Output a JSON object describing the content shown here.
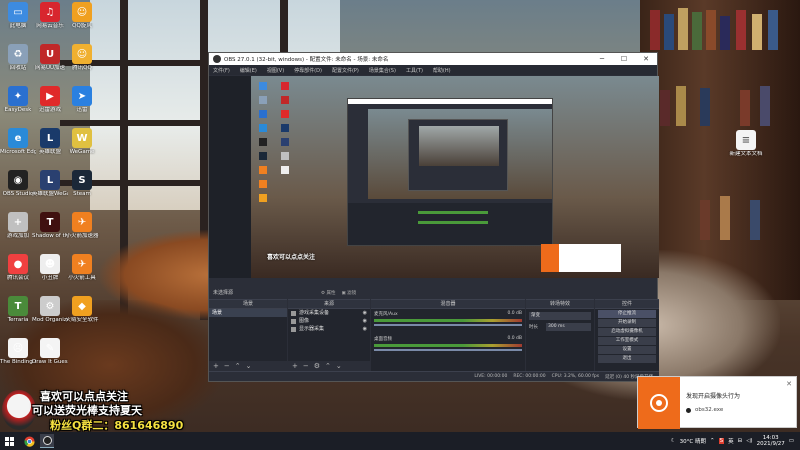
{
  "desktop_icons": [
    {
      "label": "此电脑",
      "color": "#3d8be0",
      "glyph": "▭",
      "icon": "computer-icon"
    },
    {
      "label": "网易云音乐",
      "color": "#d8262e",
      "glyph": "♫",
      "icon": "music-icon"
    },
    {
      "label": "QQ旋风",
      "color": "#f0a020",
      "glyph": "☺",
      "icon": "qq-icon"
    },
    {
      "label": "回收站",
      "color": "#8aa0b8",
      "glyph": "♻",
      "icon": "recycle-bin-icon"
    },
    {
      "label": "网易UU加速",
      "color": "#c02828",
      "glyph": "U",
      "icon": "uu-icon"
    },
    {
      "label": "腾讯QQ",
      "color": "#f0b030",
      "glyph": "☺",
      "icon": "qq-icon"
    },
    {
      "label": "EasyDesk",
      "color": "#2a70d0",
      "glyph": "✦",
      "icon": "app-icon"
    },
    {
      "label": "迅雷游戏",
      "color": "#e02a2a",
      "glyph": "▶",
      "icon": "game-icon"
    },
    {
      "label": "迅雷",
      "color": "#2a80e0",
      "glyph": "➤",
      "icon": "thunder-icon"
    },
    {
      "label": "Microsoft Edge",
      "color": "#2a8ad8",
      "glyph": "e",
      "icon": "edge-icon"
    },
    {
      "label": "英雄联盟",
      "color": "#1a3a6a",
      "glyph": "L",
      "icon": "lol-icon"
    },
    {
      "label": "WeGame",
      "color": "#e0c040",
      "glyph": "W",
      "icon": "wegame-icon"
    },
    {
      "label": "OBS Studio",
      "color": "#222",
      "glyph": "◉",
      "icon": "obs-icon"
    },
    {
      "label": "英雄联盟WeGame版",
      "color": "#2a4070",
      "glyph": "L",
      "icon": "lol-icon"
    },
    {
      "label": "Steam",
      "color": "#1b2838",
      "glyph": "S",
      "icon": "steam-icon"
    },
    {
      "label": "游戏加加",
      "color": "#c0c0c0",
      "glyph": "+",
      "icon": "app-icon"
    },
    {
      "label": "Shadow of the Tomb Raider",
      "color": "#401010",
      "glyph": "T",
      "icon": "game-icon"
    },
    {
      "label": "小火箭加速器",
      "color": "#f08020",
      "glyph": "✈",
      "icon": "rocket-icon"
    },
    {
      "label": "腾讯会议",
      "color": "#f04040",
      "glyph": "●",
      "icon": "app-icon"
    },
    {
      "label": "小丑牌",
      "color": "#eee",
      "glyph": "☻",
      "icon": "game-icon"
    },
    {
      "label": "小火箭工具",
      "color": "#f08020",
      "glyph": "✈",
      "icon": "rocket-icon"
    },
    {
      "label": "Terraria",
      "color": "#4a8a3a",
      "glyph": "T",
      "icon": "terraria-icon"
    },
    {
      "label": "Mod Organizer",
      "color": "#ccc",
      "glyph": "⚙",
      "icon": "app-icon"
    },
    {
      "label": "火绒安全软件",
      "color": "#f0a020",
      "glyph": "◆",
      "icon": "shield-icon"
    },
    {
      "label": "The Binding of Isaac: Re...",
      "color": "#f4f4f4",
      "glyph": "☹",
      "icon": "isaac-icon"
    },
    {
      "label": "Draw It Guess",
      "color": "#f4f4f4",
      "glyph": "✎",
      "icon": "draw-icon"
    }
  ],
  "desktop_right_icon": {
    "label": "新建文本文档",
    "icon": "text-file-icon"
  },
  "obs": {
    "title": "OBS 27.0.1 (32-bit, windows) - 配置文件: 未命名 - 场景: 未命名",
    "menu": [
      "文件(F)",
      "编辑(E)",
      "视图(V)",
      "停靠部件(D)",
      "配置文件(P)",
      "场景集合(S)",
      "工具(T)",
      "帮助(H)"
    ],
    "scene_bar_label": "未选择源",
    "transport": [
      "⚙ 属性",
      "▣ 滤镜"
    ],
    "docks": {
      "scenes": {
        "title": "场景",
        "items": [
          "场景"
        ]
      },
      "sources": {
        "title": "来源",
        "items": [
          "游戏采集设备",
          "图像",
          "显示器采集"
        ]
      },
      "mixer": {
        "title": "混音器",
        "channels": [
          {
            "name": "麦克风/Aux",
            "db": "0.0 dB"
          },
          {
            "name": "桌面音频",
            "db": "0.0 dB"
          }
        ]
      },
      "transitions": {
        "title": "转场特效",
        "type_label": "渐变",
        "duration_label": "时长",
        "duration": "300 ms"
      },
      "controls": {
        "title": "控件",
        "buttons": [
          "停止推流",
          "开始录制",
          "启动虚拟摄像机",
          "工作室模式",
          "设置",
          "退出"
        ]
      }
    },
    "status": [
      "LIVE: 00:00:00",
      "REC: 00:00:00",
      "CPU: 3.2%, 60.00 fps",
      "延迟 (0) 40 秒延后开播"
    ]
  },
  "toast": {
    "title": "发现开启摄像头行为",
    "process": "obs32.exe"
  },
  "overlay": {
    "line1": "喜欢可以点点关注",
    "line2": "可以送荧光棒支持夏天",
    "line3": "粉丝Q群二：861646890"
  },
  "taskbar": {
    "weather": "30°C 晴朗",
    "time": "14:03",
    "date": "2021/9/27",
    "lang": "英"
  }
}
